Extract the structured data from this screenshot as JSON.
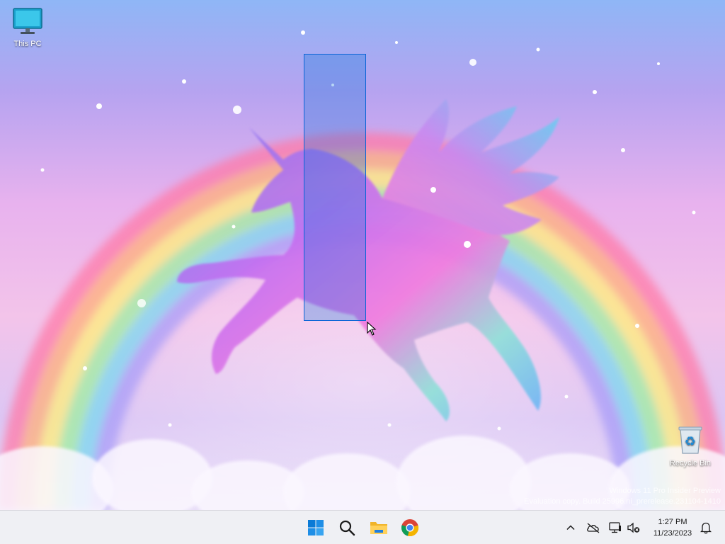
{
  "desktop": {
    "icons": [
      {
        "label": "This PC",
        "icon": "monitor-icon"
      },
      {
        "label": "Recycle Bin",
        "icon": "recycle-bin-icon"
      }
    ],
    "watermark": {
      "line1": "Windows 11 Pro Insider Preview",
      "line2": "Evaluation copy. Build 25996.ni_prerelease.231104-1410"
    }
  },
  "taskbar": {
    "apps": [
      {
        "name": "Start",
        "icon": "windows-start-icon"
      },
      {
        "name": "Search",
        "icon": "search-icon"
      },
      {
        "name": "File Explorer",
        "icon": "folder-icon"
      },
      {
        "name": "Google Chrome",
        "icon": "chrome-icon"
      }
    ],
    "tray": {
      "icons": [
        "chevron-up-icon",
        "onedrive-offline-icon",
        "network-icon",
        "volume-muted-icon",
        "notification-bell-icon"
      ],
      "time": "1:27 PM",
      "date": "11/23/2023"
    }
  },
  "colors": {
    "selection_fill": "#006edc",
    "selection_border": "#0a64d6",
    "start_blue": "#0078d4"
  }
}
